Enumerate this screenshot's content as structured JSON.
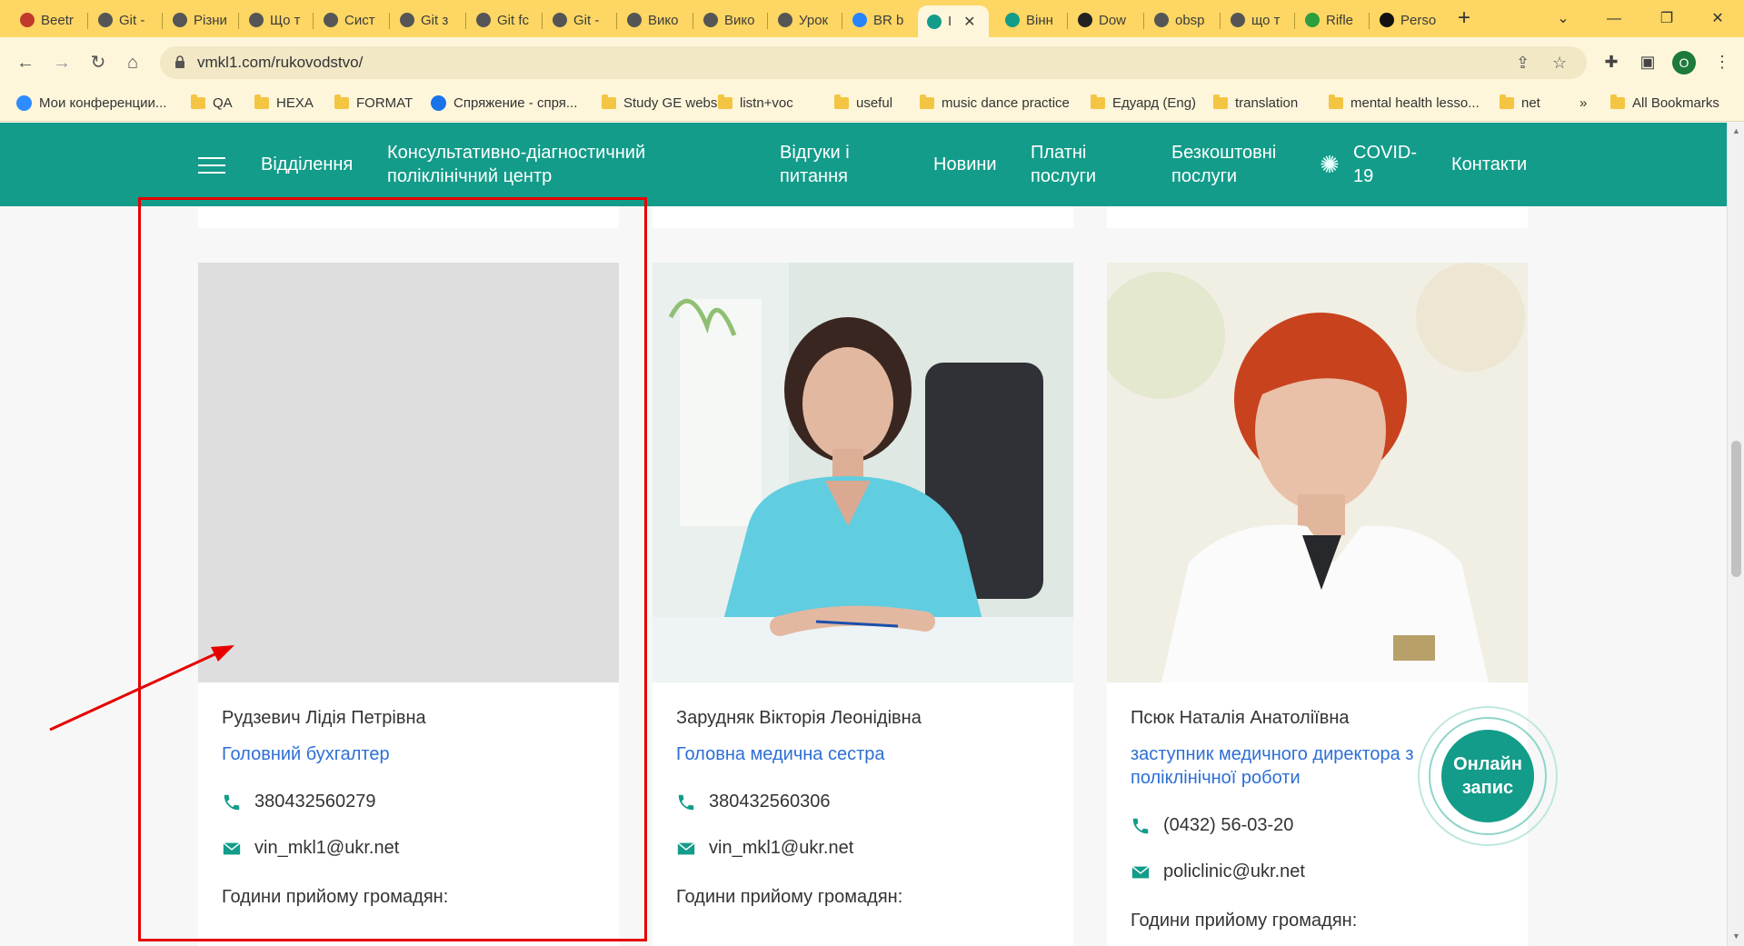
{
  "browser": {
    "tabs": [
      {
        "label": "Beetr",
        "icon": "apple-icon",
        "color": "#c0392b"
      },
      {
        "label": "Git -",
        "icon": "globe-icon",
        "color": "#555555"
      },
      {
        "label": "Різни",
        "icon": "globe-icon",
        "color": "#555555"
      },
      {
        "label": "Що т",
        "icon": "globe-icon",
        "color": "#555555"
      },
      {
        "label": "Сист",
        "icon": "globe-icon",
        "color": "#555555"
      },
      {
        "label": "Git з",
        "icon": "globe-icon",
        "color": "#555555"
      },
      {
        "label": "Git fc",
        "icon": "globe-icon",
        "color": "#555555"
      },
      {
        "label": "Git -",
        "icon": "globe-icon",
        "color": "#555555"
      },
      {
        "label": "Вико",
        "icon": "globe-icon",
        "color": "#555555"
      },
      {
        "label": "Вико",
        "icon": "globe-icon",
        "color": "#555555"
      },
      {
        "label": "Урок",
        "icon": "globe-icon",
        "color": "#555555"
      },
      {
        "label": "BR b",
        "icon": "diamond-icon",
        "color": "#2684ff"
      },
      {
        "label": "I",
        "icon": "caduceus-icon",
        "color": "#139c8a"
      },
      {
        "label": "Вінн",
        "icon": "caduceus-icon",
        "color": "#139c8a"
      },
      {
        "label": "Dow",
        "icon": "download-icon",
        "color": "#222222"
      },
      {
        "label": "obsp",
        "icon": "globe-icon",
        "color": "#555555"
      },
      {
        "label": "що т",
        "icon": "globe-icon",
        "color": "#555555"
      },
      {
        "label": "Rifle",
        "icon": "leaf-icon",
        "color": "#2e9e3e"
      },
      {
        "label": "Perso",
        "icon": "github-icon",
        "color": "#111111"
      }
    ],
    "url": "vmkl1.com/rukovodstvo/",
    "profile_initial": "O",
    "bookmarks": [
      {
        "label": "Мои конференции...",
        "icon": "zoom-icon"
      },
      {
        "label": "QA",
        "icon": "folder-icon"
      },
      {
        "label": "HEXA",
        "icon": "folder-icon"
      },
      {
        "label": "FORMAT",
        "icon": "folder-icon"
      },
      {
        "label": "Спряжение - спря...",
        "icon": "chat-icon"
      },
      {
        "label": "Study GE webs",
        "icon": "folder-icon"
      },
      {
        "label": "listn+voc",
        "icon": "folder-icon"
      },
      {
        "label": "useful",
        "icon": "folder-icon"
      },
      {
        "label": "music dance practice",
        "icon": "folder-icon"
      },
      {
        "label": "Едуард (Eng)",
        "icon": "folder-icon"
      },
      {
        "label": "translation",
        "icon": "folder-icon"
      },
      {
        "label": "mental health lesso...",
        "icon": "folder-icon"
      },
      {
        "label": "net",
        "icon": "folder-icon"
      }
    ],
    "bookmarks_overflow": "»",
    "all_bookmarks": "All Bookmarks"
  },
  "site": {
    "colors": {
      "brand": "#139c8a",
      "link": "#2d6fd6",
      "annotation": "#e60000"
    },
    "nav": {
      "departments": "Відділення",
      "center_line1": "Консультативно-діагностичний",
      "center_line2": "поліклінічний центр",
      "reviews_line1": "Відгуки і",
      "reviews_line2": "питання",
      "news": "Новини",
      "paid_line1": "Платні",
      "paid_line2": "послуги",
      "free_line1": "Безкоштовні",
      "free_line2": "послуги",
      "covid_line1": "COVID-",
      "covid_line2": "19",
      "contacts": "Контакти"
    },
    "staff": [
      {
        "name": "Рудзевич Лідія Петрівна",
        "role": "Головний бухгалтер",
        "phone": "380432560279",
        "email": "vin_mkl1@ukr.net",
        "hours": "Години прийому громадян:"
      },
      {
        "name": "Зарудняк Вікторія Леонідівна",
        "role": "Головна медична сестра",
        "phone": "380432560306",
        "email": "vin_mkl1@ukr.net",
        "hours": "Години прийому громадян:"
      },
      {
        "name": "Псюк Наталія Анатоліївна",
        "role": "заступник медичного директора з поліклінічної роботи",
        "phone": "(0432) 56-03-20",
        "email": "policlinic@ukr.net",
        "hours": "Години прийому громадян:"
      }
    ],
    "online_line1": "Онлайн",
    "online_line2": "запис"
  }
}
